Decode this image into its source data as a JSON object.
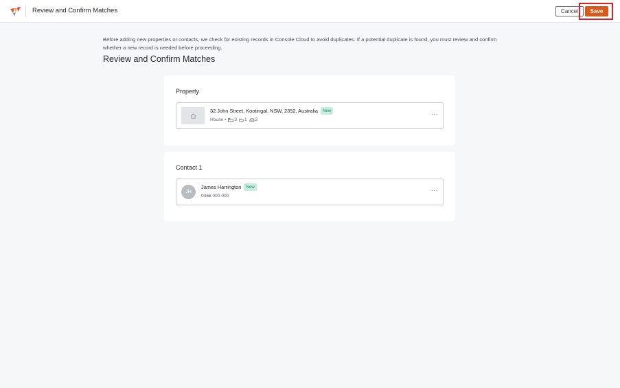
{
  "header": {
    "title": "Review and Confirm Matches",
    "cancel_label": "Cancel",
    "save_label": "Save"
  },
  "intro": {
    "text": "Before adding new properties or contacts, we check for existing records in Console Cloud to avoid duplicates. If a potential duplicate is found, you must review and confirm whether a new record is needed before proceeding.",
    "heading": "Review and Confirm Matches"
  },
  "property_section": {
    "title": "Property",
    "card": {
      "address": "32 John Street, Kootingal, NSW, 2352, Australia",
      "badge": "New",
      "type": "House",
      "separator": "•",
      "bedrooms": "3",
      "bathrooms": "1",
      "car_spaces": "2",
      "more": "···"
    }
  },
  "contact_section": {
    "title": "Contact 1",
    "card": {
      "initials": "JH",
      "name": "James Harrington",
      "badge": "New",
      "phone": "0466 000 000",
      "more": "···"
    }
  },
  "colors": {
    "accent": "#d85a1a",
    "highlight": "#e01e26",
    "badge_bg": "#c9ede0",
    "badge_text": "#1d8a63"
  }
}
